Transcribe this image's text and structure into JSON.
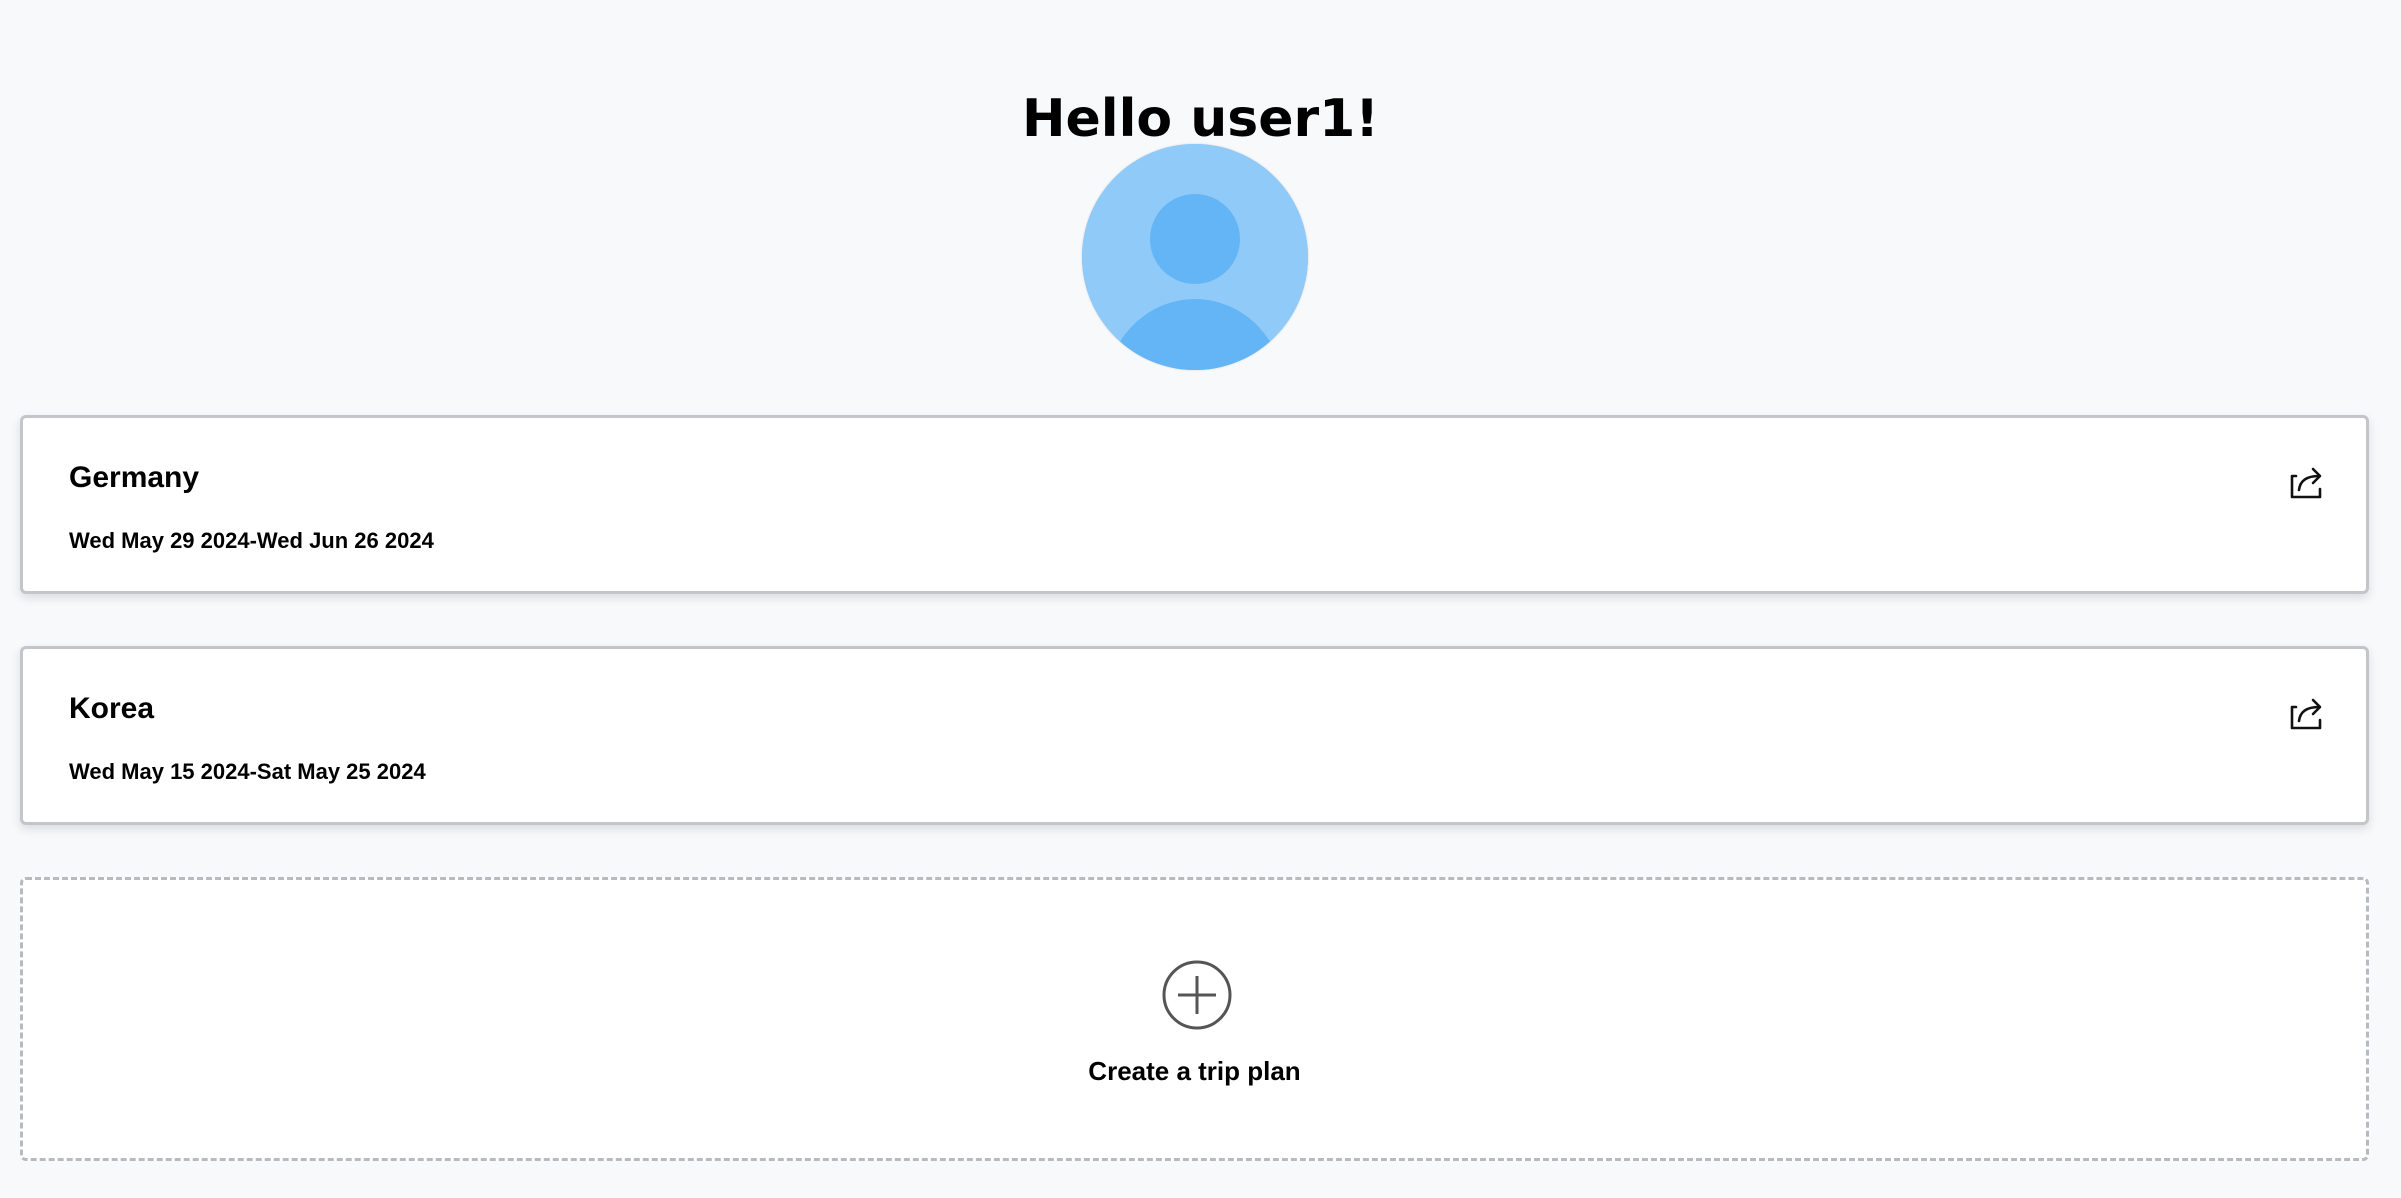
{
  "header": {
    "greeting": "Hello user1!"
  },
  "avatar": {
    "icon": "user-avatar-icon",
    "background_color": "#90caf9",
    "figure_color": "#64b5f6"
  },
  "trips": [
    {
      "name": "Germany",
      "dates": "Wed May 29 2024-Wed Jun 26 2024",
      "share_icon": "share-icon"
    },
    {
      "name": "Korea",
      "dates": "Wed May 15 2024-Sat May 25 2024",
      "share_icon": "share-icon"
    }
  ],
  "create": {
    "label": "Create a trip plan",
    "icon": "plus-circle-icon"
  }
}
